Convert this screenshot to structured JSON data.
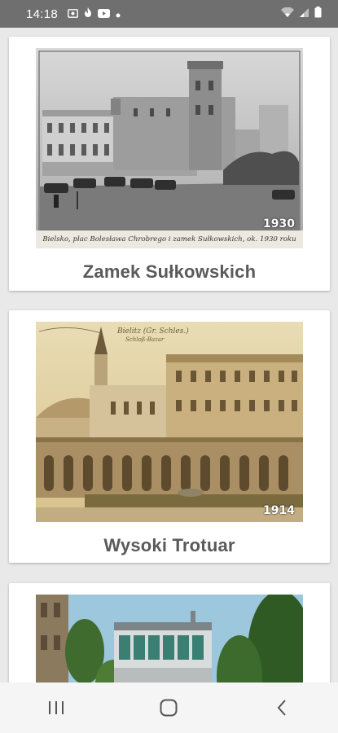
{
  "status_bar": {
    "time": "14:18",
    "icons_left": [
      "image-icon",
      "fire-icon",
      "youtube-icon",
      "dot-icon"
    ],
    "icons_right": [
      "wifi-icon",
      "signal-icon",
      "battery-icon"
    ]
  },
  "cards": [
    {
      "title": "Zamek Sułkowskich",
      "year": "1930",
      "caption": "Bielsko, plac Bolesława Chrobrego i zamek Sułkowskich, ok. 1930 roku"
    },
    {
      "title": "Wysoki Trotuar",
      "year": "1914",
      "caption": "Bielitz (Gr. Schles.) Schloß-Bazar"
    },
    {
      "title": "",
      "year": "",
      "caption": ""
    }
  ],
  "nav_bar": {
    "buttons": [
      "recent-apps",
      "home",
      "back"
    ]
  },
  "colors": {
    "status_bar_bg": "#6f6f6f",
    "page_bg": "#e9e9e9",
    "card_bg": "#ffffff",
    "title_text": "#5a5a5a"
  }
}
